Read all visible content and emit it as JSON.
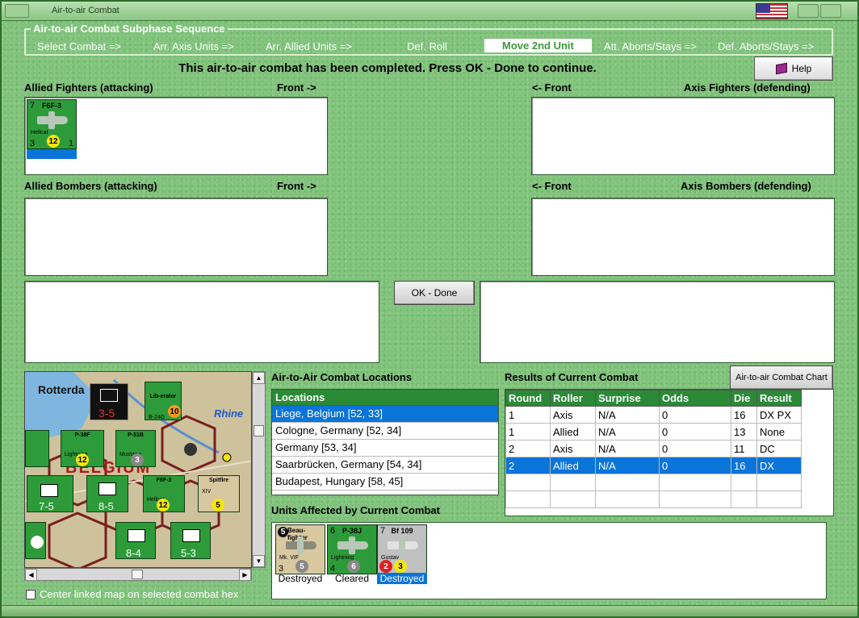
{
  "window": {
    "title": "Air-to-air Combat"
  },
  "subphase": {
    "legend": "Air-to-air Combat Subphase Sequence",
    "steps": [
      "Select Combat =>",
      "Arr. Axis Units =>",
      "Arr. Allied Units =>",
      "Def. Roll",
      "Move 2nd Unit",
      "Att. Aborts/Stays =>",
      "Def. Aborts/Stays =>"
    ],
    "active_index": 4
  },
  "message": "This air-to-air combat has been completed.  Press OK - Done to continue.",
  "help_label": "Help",
  "fighters": {
    "allied_title": "Allied Fighters (attacking)",
    "allied_front": "Front ->",
    "axis_front": "<- Front",
    "axis_title": "Axis Fighters (defending)"
  },
  "bombers": {
    "allied_title": "Allied Bombers (attacking)",
    "allied_front": "Front ->",
    "axis_front": "<- Front",
    "axis_title": "Axis Bombers (defending)"
  },
  "allied_fighter_counter": {
    "strength": "7",
    "name": "F6F-3",
    "subname": "Hellcat",
    "bottom_left": "3",
    "bottom_right": "1",
    "value": "12"
  },
  "ok_label": "OK - Done",
  "chart_button": "Air-to-air Combat Chart",
  "locations": {
    "title": "Air-to-Air Combat Locations",
    "header": "Locations",
    "items": [
      "Liege, Belgium [52, 33]",
      "Cologne, Germany [52, 34]",
      "Germany [53, 34]",
      "Saarbrücken, Germany [54, 34]",
      "Budapest, Hungary [58, 45]"
    ],
    "selected_index": 0
  },
  "results": {
    "title": "Results of Current Combat",
    "columns": [
      "Round",
      "Roller",
      "Surprise",
      "Odds",
      "Die",
      "Result"
    ],
    "rows": [
      [
        "1",
        "Axis",
        "N/A",
        "0",
        "16",
        "DX PX"
      ],
      [
        "1",
        "Allied",
        "N/A",
        "0",
        "13",
        "None"
      ],
      [
        "2",
        "Axis",
        "N/A",
        "0",
        "11",
        "DC"
      ],
      [
        "2",
        "Allied",
        "N/A",
        "0",
        "16",
        "DX"
      ]
    ],
    "selected_index": 3
  },
  "units_affected": {
    "title": "Units Affected by Current Combat",
    "units": [
      {
        "name": "Beau-fighter",
        "sub": "Mk. VIF",
        "strength": "5",
        "low_left": "3",
        "value": "5",
        "status": "Destroyed"
      },
      {
        "name": "P-38J",
        "sub": "Lightning",
        "strength": "6",
        "low_left": "4",
        "value": "6",
        "status": "Cleared"
      },
      {
        "name": "Bf 109",
        "sub": "Gustav",
        "strength": "7",
        "low_left": "2",
        "value": "3",
        "status": "Destroyed"
      }
    ]
  },
  "map": {
    "labels": {
      "rotterdam": "Rotterda",
      "rhine": "Rhine",
      "belgium": "BELGIUM"
    },
    "counters": [
      {
        "name": "P-38F",
        "sub": "Lightning",
        "value": "12"
      },
      {
        "name": "P-51B",
        "sub": "Mustang",
        "value": "3"
      },
      {
        "name": "F6F-3",
        "sub": "Hellcat",
        "value": "12"
      },
      {
        "name": "Spitfire",
        "sub": "XIV",
        "value": "5"
      },
      {
        "name": "Lib-erator",
        "sub": "B-24G",
        "value": "10"
      }
    ],
    "ground_units": [
      "3-5",
      "7-5",
      "8-5",
      "8-4",
      "5-3"
    ]
  },
  "center_map_label": "Center linked map on selected combat hex"
}
